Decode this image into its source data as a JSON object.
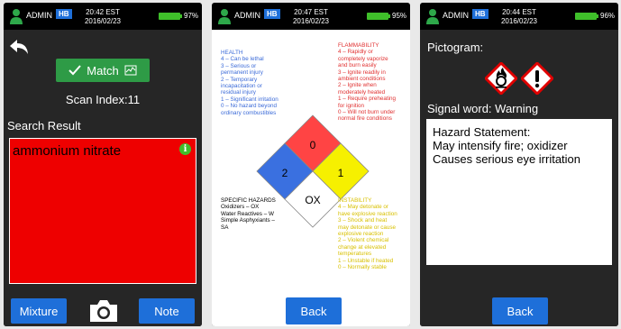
{
  "panels": [
    {
      "admin": "ADMIN",
      "hb": "HB",
      "time": "20:42 EST",
      "date": "2016/02/23",
      "battery": "97%"
    },
    {
      "admin": "ADMIN",
      "hb": "HB",
      "time": "20:47 EST",
      "date": "2016/02/23",
      "battery": "95%"
    },
    {
      "admin": "ADMIN",
      "hb": "HB",
      "time": "20:44 EST",
      "date": "2016/02/23",
      "battery": "96%"
    }
  ],
  "scan": {
    "match_label": "Match",
    "scan_index": "Scan Index:11",
    "search_result_label": "Search Result",
    "result": "ammonium nitrate",
    "info_glyph": "i",
    "mixture_label": "Mixture",
    "note_label": "Note"
  },
  "nfpa": {
    "health_title": "HEALTH",
    "health_lines": [
      "4 – Can be lethal",
      "3 – Serious or",
      "permanent injury",
      "2 – Temporary",
      "incapacitation or",
      "residual injury",
      "1 – Significant irritation",
      "0 – No hazard beyond",
      "ordinary combustibles"
    ],
    "flam_title": "FLAMMABILITY",
    "flam_lines": [
      "4 – Rapidly or",
      "completely vaporize",
      "and burn easily",
      "3 – Ignite readily in",
      "ambient conditions",
      "2 – Ignite when",
      "moderately heated",
      "1 – Require preheating",
      "for ignition",
      "0 – Will not burn under",
      "normal fire conditions"
    ],
    "special_title": "SPECIFIC HAZARDS",
    "special_lines": [
      "Oxidizers – OX",
      "Water Reactives – W",
      "Simple Asphyxiants –",
      "SA"
    ],
    "instab_title": "INSTABILITY",
    "instab_lines": [
      "4 – May detonate or",
      "have explosive reaction",
      "3 – Shock and heat",
      "may detonate or cause",
      "explosive reaction",
      "2 – Violent chemical",
      "change at elevated",
      "temperatures",
      "1 – Unstable if heated",
      "0 – Normally stable"
    ],
    "flammability": "0",
    "health": "2",
    "instability": "1",
    "special": "OX",
    "back_label": "Back"
  },
  "ghs": {
    "pictogram_label": "Pictogram:",
    "signal_word": "Signal word: Warning",
    "statement_title": "Hazard Statement:",
    "statements": [
      "May intensify fire; oxidizer",
      "Causes serious eye irritation"
    ],
    "pictograms": [
      "flame-over-circle",
      "exclamation-mark"
    ],
    "back_label": "Back"
  },
  "colors": {
    "accent_blue": "#1e6fd9",
    "match_green": "#2e9b46",
    "result_red": "#ee0000",
    "battery_green": "#3fbf2a"
  }
}
